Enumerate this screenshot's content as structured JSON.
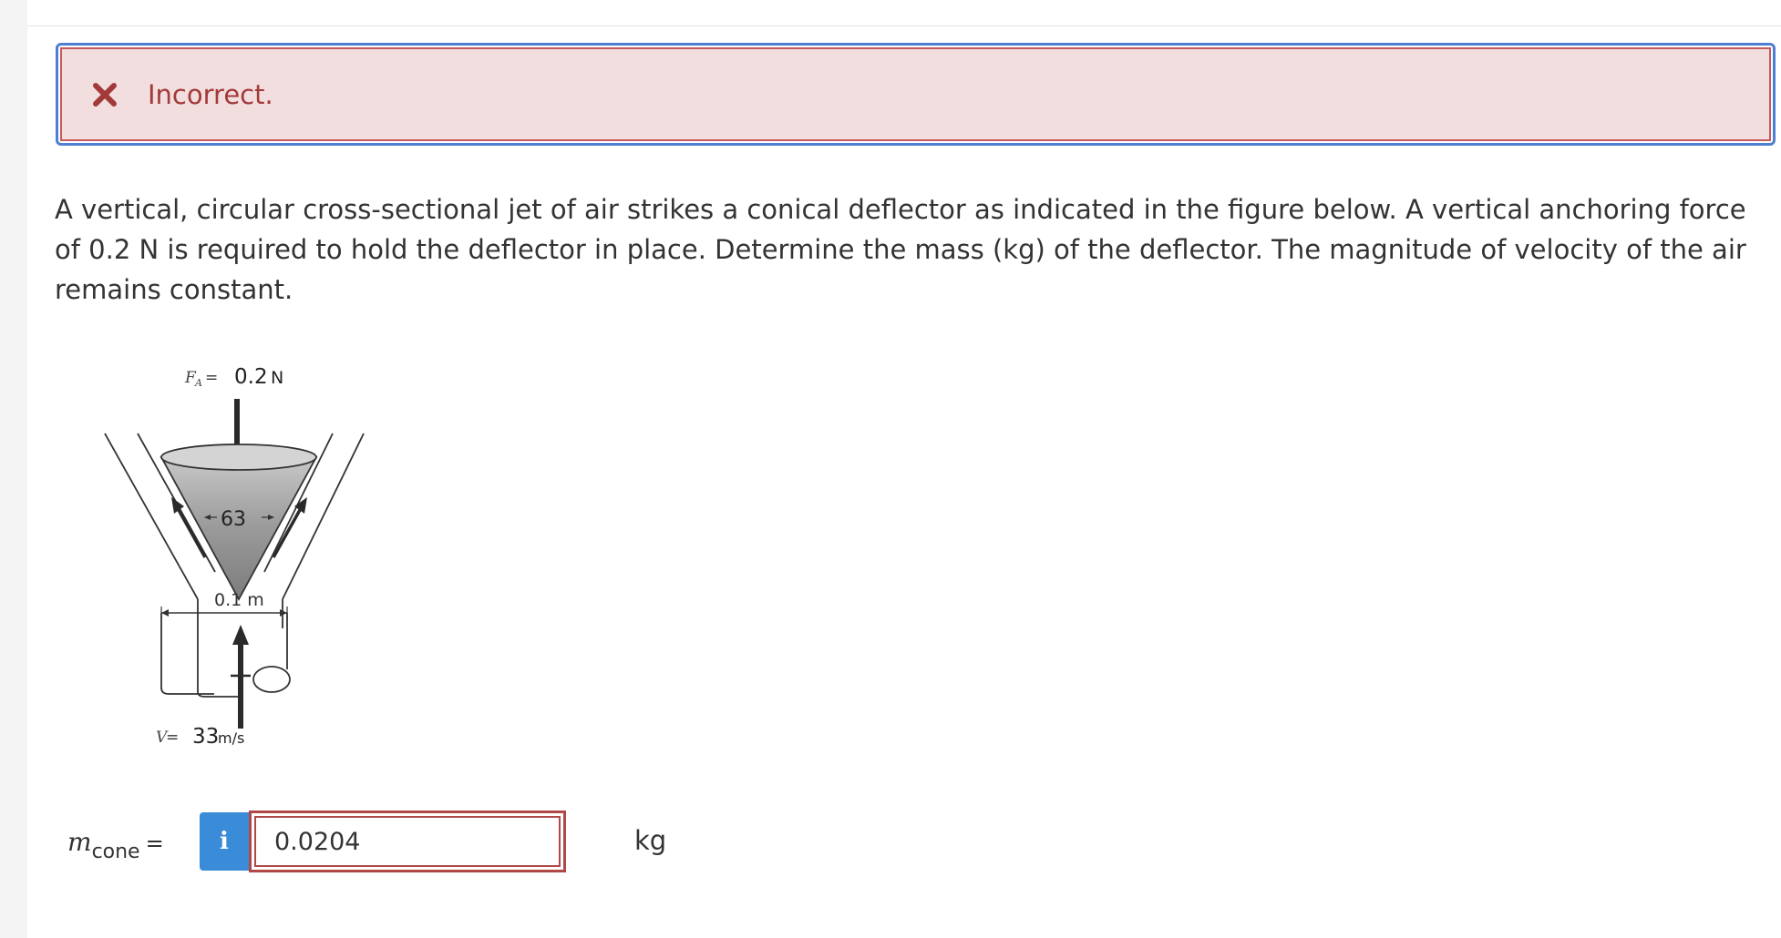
{
  "feedback": {
    "status_text": "Incorrect.",
    "icon": "close-icon",
    "colors": {
      "border": "#4f7fd1",
      "background": "#f2dedf",
      "text": "#a33a3a"
    }
  },
  "question": {
    "text": "A vertical, circular cross-sectional jet of air strikes a conical deflector as indicated in the figure below. A vertical anchoring force of 0.2 N is required to hold the deflector in place. Determine the mass (kg) of the deflector. The magnitude of velocity of the air remains constant."
  },
  "figure": {
    "force_symbol": "F",
    "force_sub": "A",
    "force_eq": " = ",
    "force_value": "0.2",
    "force_unit": "N",
    "angle_label": "63",
    "diameter_label": "0.1 m",
    "velocity_symbol": "V",
    "velocity_eq": " = ",
    "velocity_value": "33",
    "velocity_unit": "m/s"
  },
  "answer": {
    "variable": "m",
    "variable_sub": "cone",
    "equals": "=",
    "info_label": "i",
    "value": "0.0204",
    "unit": "kg"
  }
}
